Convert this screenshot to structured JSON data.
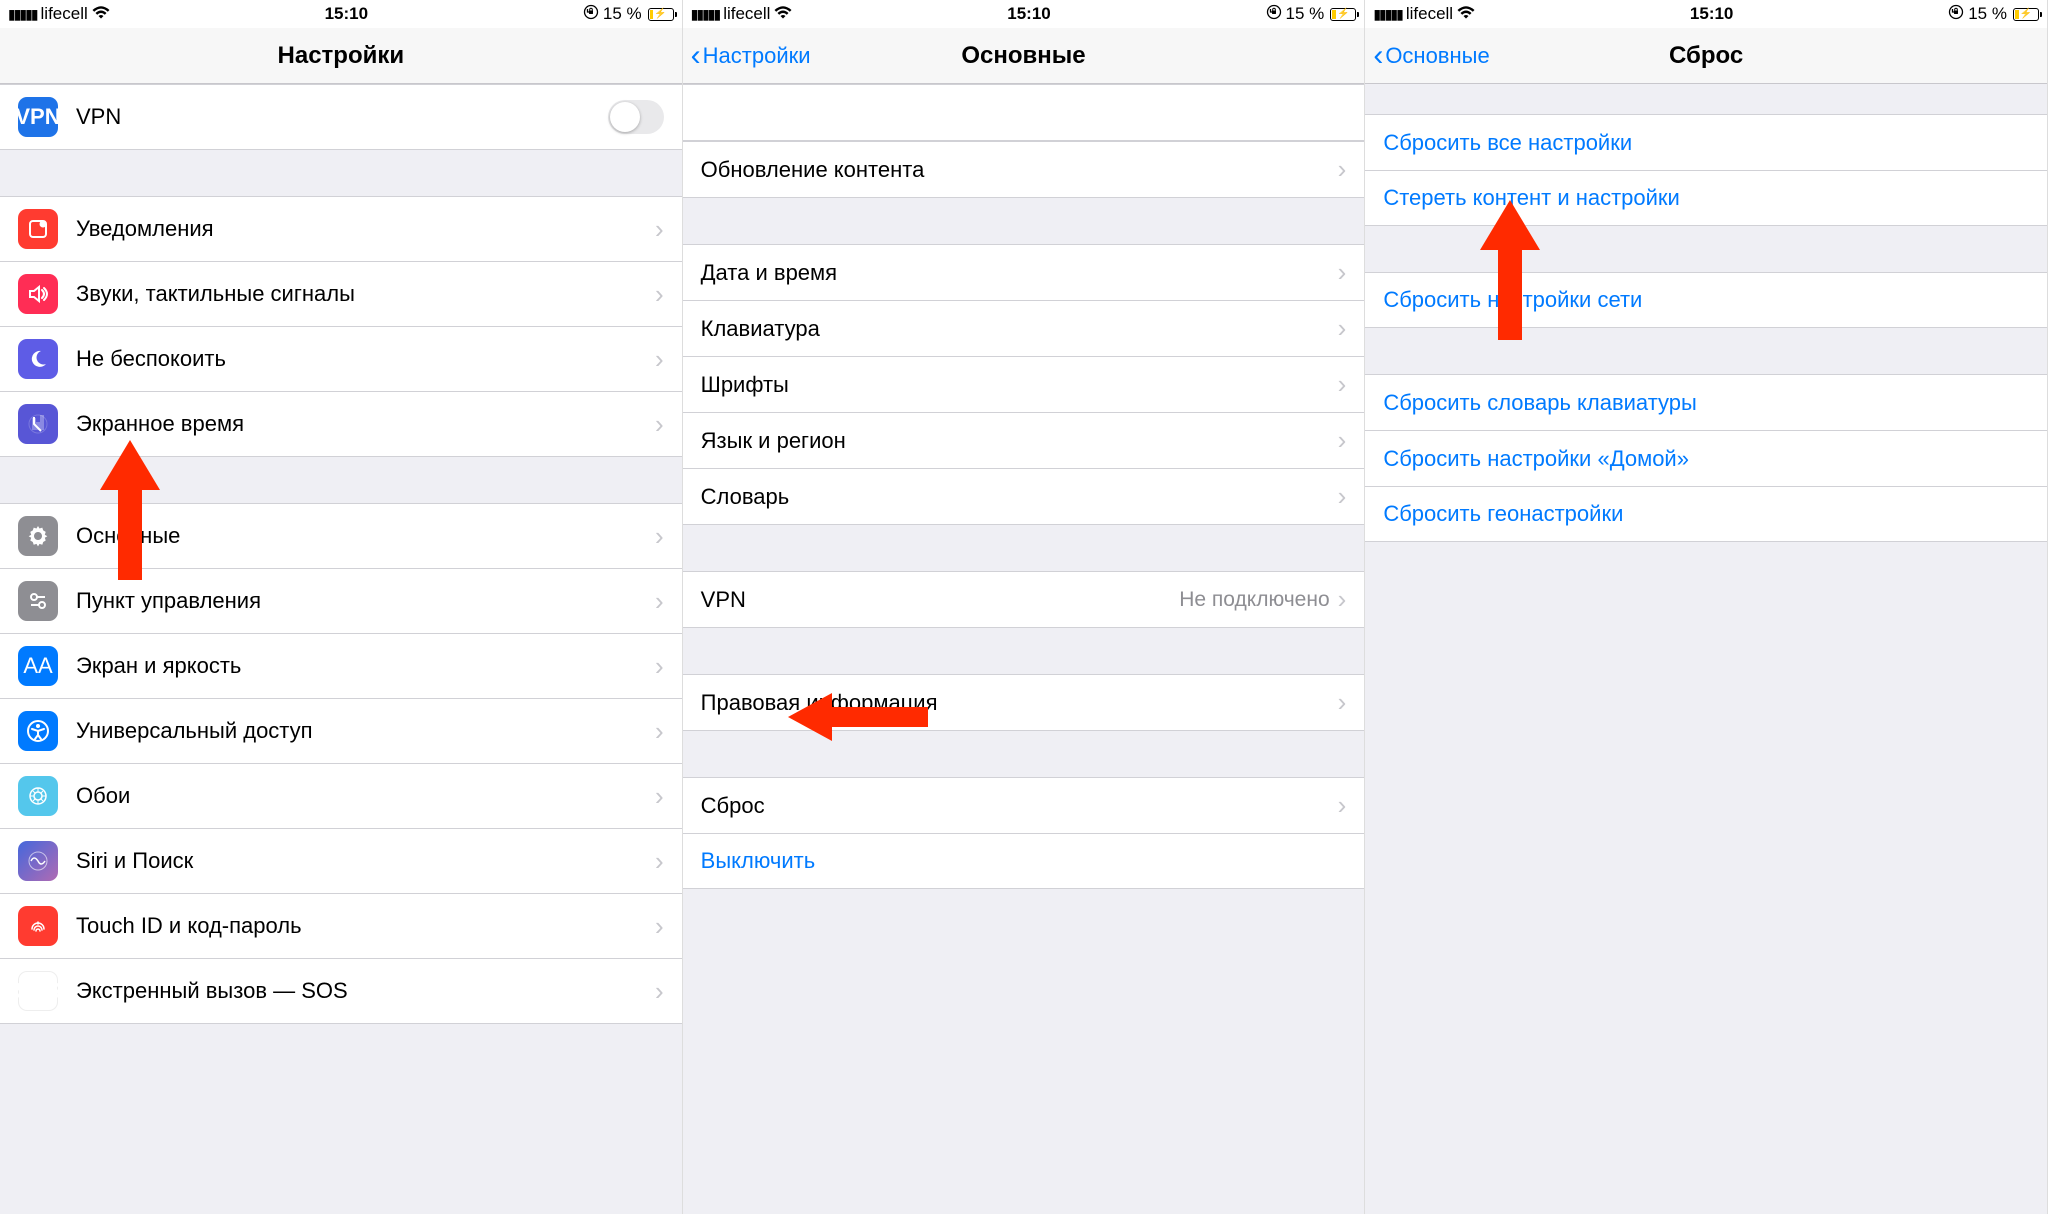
{
  "status": {
    "carrier": "lifecell",
    "time": "15:10",
    "battery_percent": "15 %"
  },
  "screen1": {
    "title": "Настройки",
    "vpn": "VPN",
    "items": {
      "notifications": "Уведомления",
      "sounds": "Звуки, тактильные сигналы",
      "dnd": "Не беспокоить",
      "screen_time": "Экранное время",
      "general": "Основные",
      "control_center": "Пункт управления",
      "display": "Экран и яркость",
      "accessibility": "Универсальный доступ",
      "wallpaper": "Обои",
      "siri": "Siri и Поиск",
      "touchid": "Touch ID и код-пароль",
      "sos": "Экстренный вызов — SOS"
    }
  },
  "screen2": {
    "back": "Настройки",
    "title": "Основные",
    "items": {
      "background_refresh": "Обновление контента",
      "date_time": "Дата и время",
      "keyboard": "Клавиатура",
      "fonts": "Шрифты",
      "language": "Язык и регион",
      "dictionary": "Словарь",
      "vpn": "VPN",
      "vpn_status": "Не подключено",
      "legal": "Правовая информация",
      "reset": "Сброс",
      "shutdown": "Выключить"
    }
  },
  "screen3": {
    "back": "Основные",
    "title": "Сброс",
    "items": {
      "reset_all": "Сбросить все настройки",
      "erase_all": "Стереть контент и настройки",
      "reset_network": "Сбросить настройки сети",
      "reset_keyboard": "Сбросить словарь клавиатуры",
      "reset_home": "Сбросить настройки «Домой»",
      "reset_location": "Сбросить геонастройки"
    }
  }
}
